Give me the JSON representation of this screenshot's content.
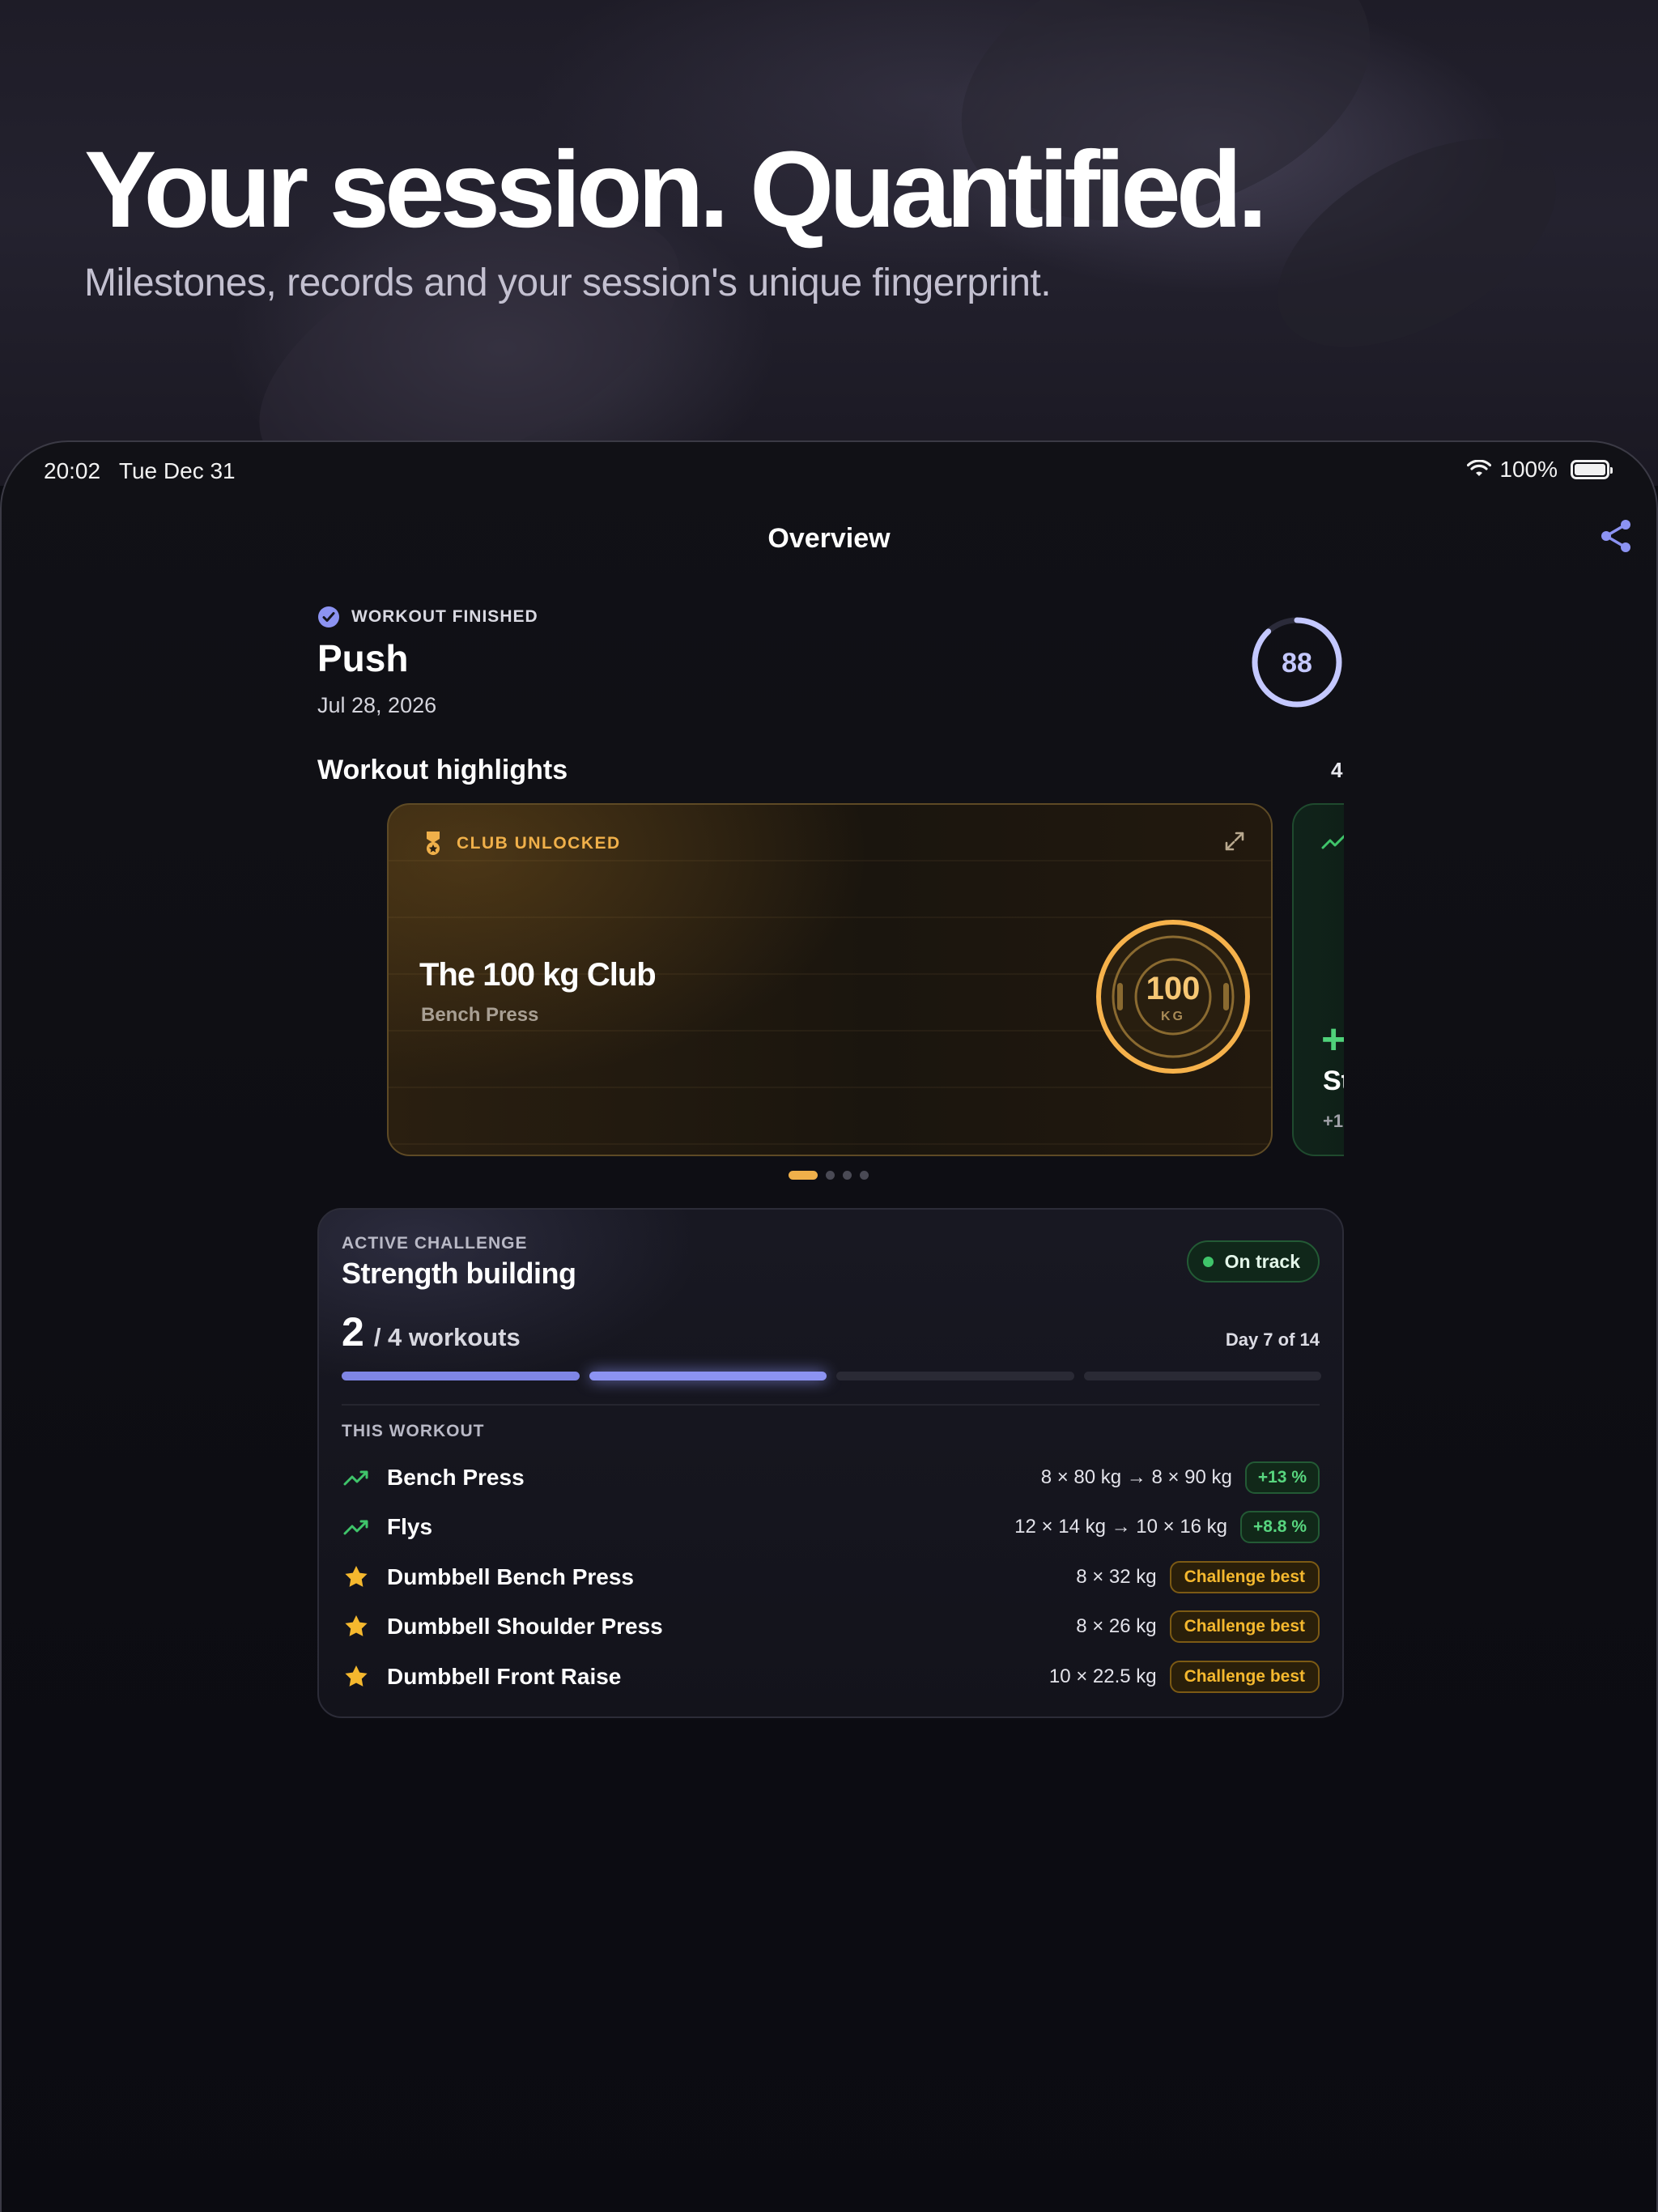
{
  "hero": {
    "title": "Your session. Quantified.",
    "subtitle": "Milestones, records and your session's unique fingerprint."
  },
  "status_bar": {
    "time": "20:02",
    "date": "Tue Dec 31",
    "battery": "100%",
    "icons": [
      "wifi-icon",
      "battery-icon"
    ]
  },
  "nav": {
    "title": "Overview",
    "share_icon": "share-icon"
  },
  "workout": {
    "status": "WORKOUT FINISHED",
    "name": "Push",
    "date": "Jul 28, 2026",
    "score": "88",
    "score_fraction": 0.88
  },
  "highlights": {
    "title": "Workout highlights",
    "count": "4",
    "cards": [
      {
        "tag": "CLUB UNLOCKED",
        "title": "The 100 kg Club",
        "subtitle": "Bench Press",
        "medal_value": "100",
        "medal_unit": "KG"
      },
      {
        "title": "St",
        "subtitle": "+1",
        "plus": "+"
      }
    ],
    "page_count": 4,
    "active_page": 0
  },
  "challenge": {
    "eyebrow": "ACTIVE CHALLENGE",
    "title": "Strength building",
    "status": "On track",
    "progress_done": "2",
    "progress_total_label": "/ 4 workouts",
    "day_label": "Day 7 of 14",
    "segments_total": 4,
    "segments_done": 2,
    "this_workout_label": "THIS WORKOUT",
    "exercises": [
      {
        "name": "Bench Press",
        "icon": "trend-up-icon",
        "detail": "8 × 80 kg → 8 × 90 kg",
        "badge": "+13 %",
        "badge_type": "green"
      },
      {
        "name": "Flys",
        "icon": "trend-up-icon",
        "detail": "12 × 14 kg → 10 × 16 kg",
        "badge": "+8.8 %",
        "badge_type": "green"
      },
      {
        "name": "Dumbbell Bench Press",
        "icon": "star-icon",
        "detail": "8 × 32 kg",
        "badge": "Challenge best",
        "badge_type": "gold"
      },
      {
        "name": "Dumbbell Shoulder Press",
        "icon": "star-icon",
        "detail": "8 × 26 kg",
        "badge": "Challenge best",
        "badge_type": "gold"
      },
      {
        "name": "Dumbbell Front Raise",
        "icon": "star-icon",
        "detail": "10 × 22.5 kg",
        "badge": "Challenge best",
        "badge_type": "gold"
      }
    ]
  },
  "colors": {
    "accent": "#8c93f2",
    "gold": "#f0b04a",
    "green": "#3fc46a",
    "background": "#0c0c12"
  }
}
